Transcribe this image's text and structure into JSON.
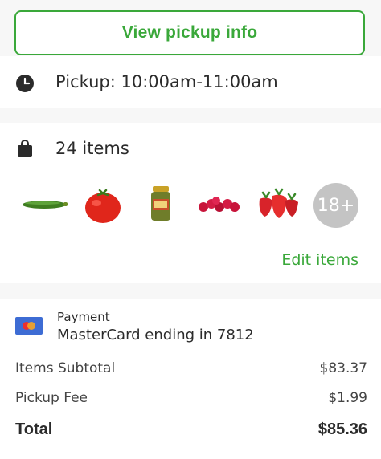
{
  "pickup_info_button": "View pickup info",
  "pickup": {
    "label": "Pickup: 10:00am-11:00am",
    "icon": "clock-icon"
  },
  "items": {
    "count_label": "24 items",
    "icon": "shopping-bag-icon",
    "thumbnails": [
      "cucumber",
      "tomato",
      "pickle-jar",
      "raspberries",
      "strawberries"
    ],
    "more_badge": "18+",
    "edit_label": "Edit items"
  },
  "payment": {
    "label": "Payment",
    "card": "MasterCard ending in 7812",
    "icon": "mastercard-icon"
  },
  "summary": {
    "subtotal_label": "Items Subtotal",
    "subtotal_value": "$83.37",
    "fee_label": "Pickup Fee",
    "fee_value": "$1.99",
    "total_label": "Total",
    "total_value": "$85.36"
  },
  "colors": {
    "accent": "#3aa83a",
    "badge": "#c4c4c4",
    "section_gap": "#f7f7f7"
  }
}
